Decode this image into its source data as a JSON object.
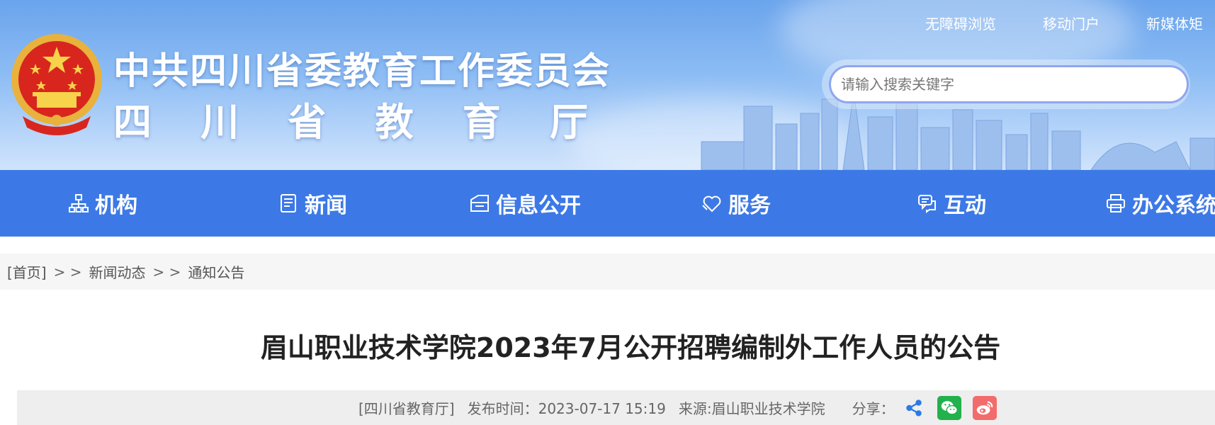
{
  "header": {
    "title": "中共四川省委教育工作委员会",
    "dept_chars": [
      "四",
      "川",
      "省",
      "教",
      "育",
      "厅"
    ],
    "top_links": [
      "无障碍浏览",
      "移动门户",
      "新媒体矩"
    ],
    "search": {
      "placeholder": "请输入搜索关键字"
    }
  },
  "nav": {
    "items": [
      {
        "label": "机构",
        "icon": "org-chart-icon"
      },
      {
        "label": "新闻",
        "icon": "news-icon"
      },
      {
        "label": "信息公开",
        "icon": "info-folder-icon"
      },
      {
        "label": "服务",
        "icon": "heart-hand-icon"
      },
      {
        "label": "互动",
        "icon": "chat-icon"
      },
      {
        "label": "办公系统",
        "icon": "printer-icon"
      }
    ]
  },
  "breadcrumb": {
    "home": "[首页]",
    "separator": "> >",
    "level1": "新闻动态",
    "level2": "通知公告"
  },
  "article": {
    "title": "眉山职业技术学院2023年7月公开招聘编制外工作人员的公告",
    "publisher": "[四川省教育厅]",
    "publish_time": "发布时间：2023-07-17 15:19",
    "source": "来源:眉山职业技术学院",
    "share_label": "分享：",
    "share_icons": [
      "share-icon",
      "wechat-icon",
      "weibo-icon"
    ]
  },
  "colors": {
    "nav_bg": "#3d79e6",
    "wechat": "#22b14c",
    "weibo": "#f36c6c",
    "share": "#2a7ae4"
  }
}
